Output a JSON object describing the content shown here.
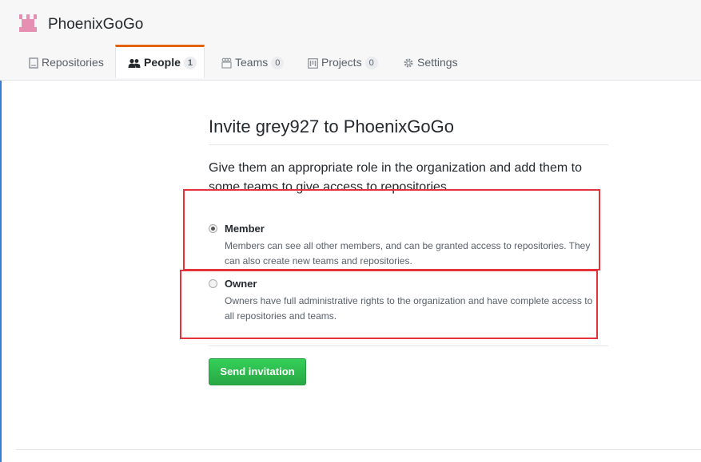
{
  "org": {
    "name": "PhoenixGoGo",
    "avatar_icon": "org-avatar-icon"
  },
  "tabs": [
    {
      "label": "Repositories",
      "icon": "repo-icon",
      "count": null
    },
    {
      "label": "People",
      "icon": "people-icon",
      "count": "1"
    },
    {
      "label": "Teams",
      "icon": "teams-icon",
      "count": "0"
    },
    {
      "label": "Projects",
      "icon": "project-icon",
      "count": "0"
    },
    {
      "label": "Settings",
      "icon": "gear-icon",
      "count": null
    }
  ],
  "invite": {
    "title": "Invite grey927 to PhoenixGoGo",
    "description": "Give them an appropriate role in the organization and add them to some teams to give access to repositories.",
    "roles": [
      {
        "label": "Member",
        "checked": true,
        "note": "Members can see all other members, and can be granted access to repositories. They can also create new teams and repositories."
      },
      {
        "label": "Owner",
        "checked": false,
        "note": "Owners have full administrative rights to the organization and have complete access to all repositories and teams."
      }
    ],
    "submit_label": "Send invitation"
  },
  "colors": {
    "accent_tab": "#e36209",
    "button_green": "#28a745",
    "highlight_red": "#e5333c"
  }
}
